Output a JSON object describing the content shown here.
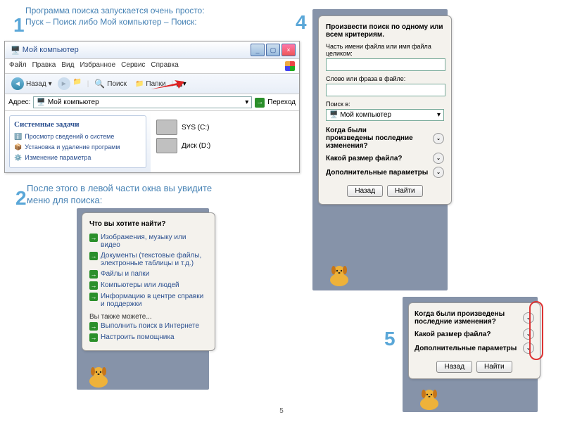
{
  "step1": {
    "num": "1",
    "text": "Программа поиска запускается очень просто: Пуск – Поиск либо Мой компьютер – Поиск:"
  },
  "step2": {
    "num": "2",
    "text": "После этого в левой части окна вы увидите меню для поиска:"
  },
  "step4": {
    "num": "4"
  },
  "step5": {
    "num": "5"
  },
  "explorer": {
    "title": "Мой компьютер",
    "menu": [
      "Файл",
      "Правка",
      "Вид",
      "Избранное",
      "Сервис",
      "Справка"
    ],
    "back": "Назад",
    "search": "Поиск",
    "folders": "Папки",
    "addr_label": "Адрес:",
    "addr_value": "Мой компьютер",
    "go": "Переход",
    "tasks_header": "Системные задачи",
    "tasks": [
      "Просмотр сведений о системе",
      "Установка и удаление программ",
      "Изменение параметра"
    ],
    "drives": [
      "SYS (C:)",
      "Диск (D:)"
    ]
  },
  "menu": {
    "header": "Что вы хотите найти?",
    "items": [
      "Изображения, музыку или видео",
      "Документы (текстовые файлы, электронные таблицы и т.д.)",
      "Файлы и папки",
      "Компьютеры или людей",
      "Информацию в центре справки и поддержки"
    ],
    "also": "Вы также можете...",
    "also_items": [
      "Выполнить поиск в Интернете",
      "Настроить помощника"
    ]
  },
  "advanced": {
    "header": "Произвести поиск по одному или всем критериям.",
    "filename": "Часть имени файла или имя файла целиком:",
    "word": "Слово или фраза в файле:",
    "searchin": "Поиск в:",
    "searchin_value": "Мой компьютер",
    "when": "Когда были произведены последние изменения?",
    "size": "Какой размер файла?",
    "extra": "Дополнительные параметры",
    "back": "Назад",
    "find": "Найти"
  },
  "page_number": "5"
}
